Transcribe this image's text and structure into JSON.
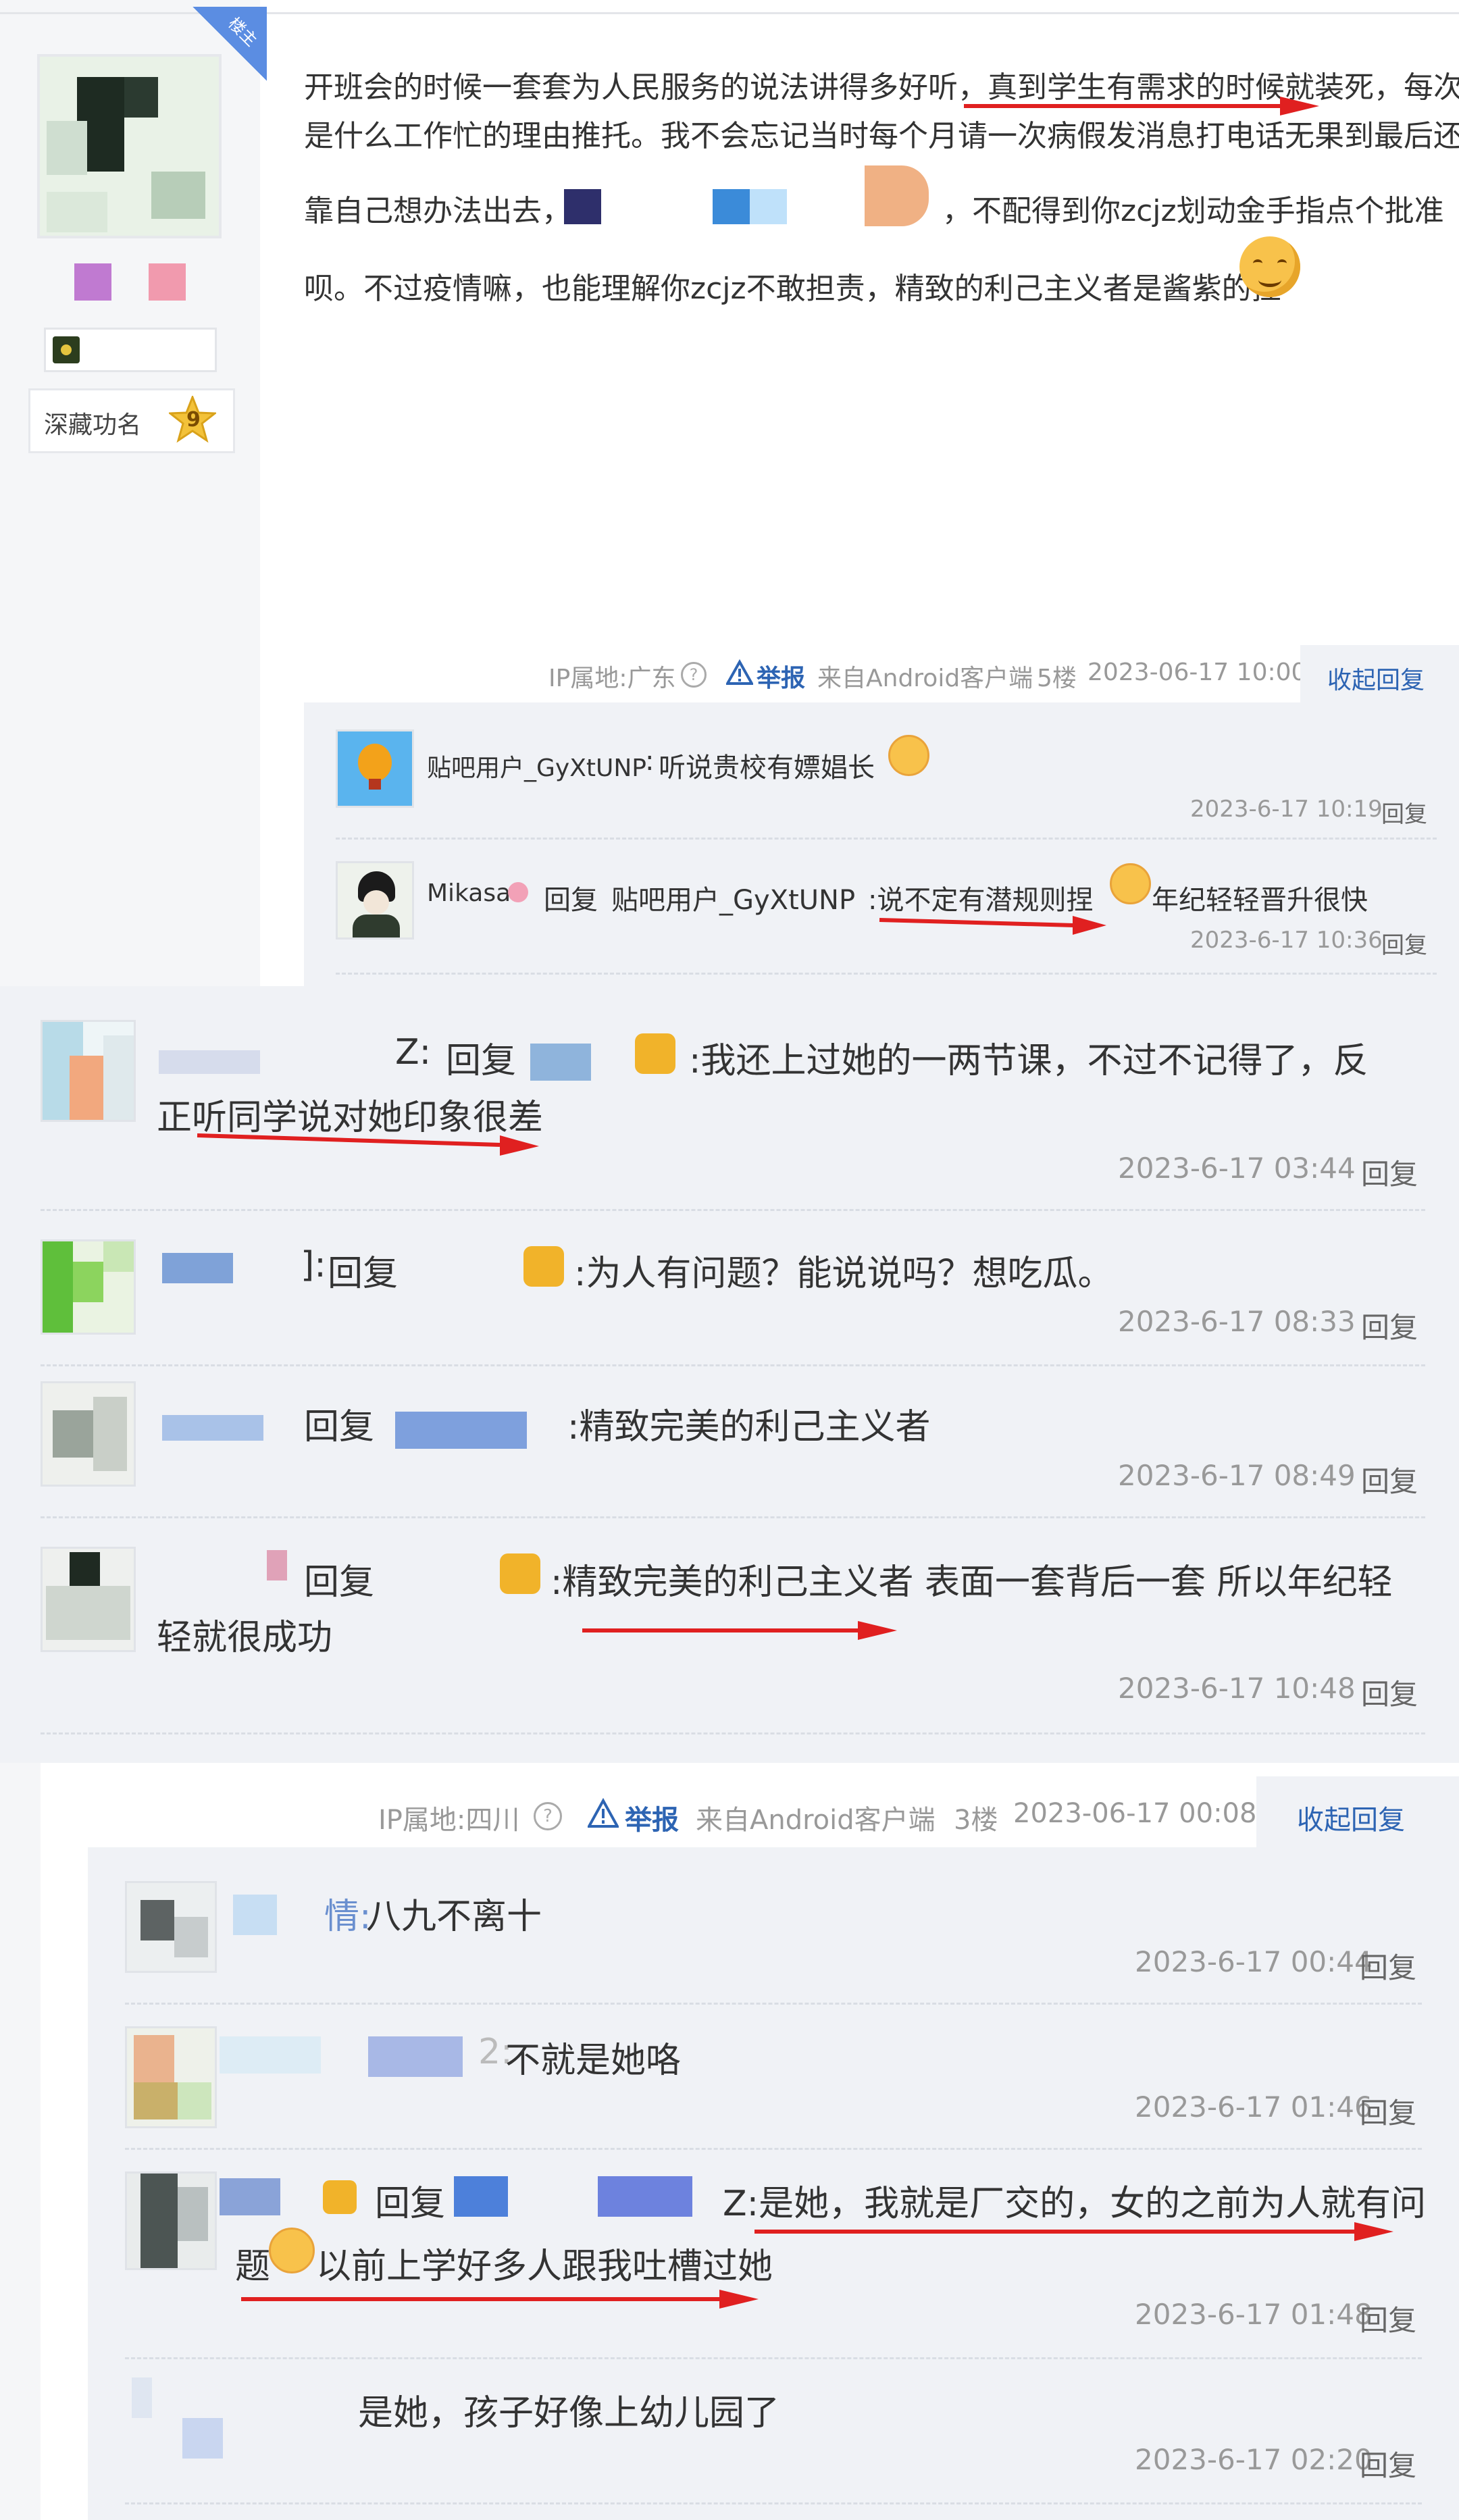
{
  "post": {
    "badge": "楼主",
    "lines": [
      "开班会的时候一套套为人民服务的说法讲得多好听，真到学生有需求的时候就装死，每次都",
      "是什么工作忙的理由推托。我不会忘记当时每个月请一次病假发消息打电话无果到最后还得",
      "靠自己想办法出去，",
      "，不配得到你zcjz划动金手指点个批准",
      "呗。不过疫情嘛，也能理解你zcjz不敢担责，精致的利己主义者是酱紫的捏"
    ],
    "rank": "深藏功名",
    "level": "9",
    "meta": {
      "ip": "IP属地:广东",
      "report": "举报",
      "client": "来自Android客户端",
      "floor": "5楼",
      "time": "2023-06-17 10:00",
      "collapse": "收起回复"
    },
    "replies": [
      {
        "user": "贴吧用户_GyXtUNP",
        "sep": ":",
        "text": "听说贵校有嫖娼长",
        "time": "2023-6-17 10:19",
        "reply": "回复"
      },
      {
        "user": "Mikasa",
        "reply_word": "回复",
        "target": "贴吧用户_GyXtUNP",
        "text1": ":说不定有潜规则捏",
        "text2": "年纪轻轻晋升很快",
        "time": "2023-6-17 10:36",
        "reply": "回复"
      }
    ]
  },
  "thread2": {
    "items": [
      {
        "lead": "Z:",
        "reply_word": "回复",
        "line1": ":我还上过她的一两节课，不过不记得了，反",
        "line2": "正听同学说对她印象很差",
        "time": "2023-6-17 03:44",
        "reply": "回复"
      },
      {
        "lead": "]:",
        "reply_word": "回复",
        "line1": ":为人有问题？能说说吗？想吃瓜。",
        "time": "2023-6-17 08:33",
        "reply": "回复"
      },
      {
        "reply_word": "回复",
        "line1": ":精致完美的利己主义者",
        "time": "2023-6-17 08:49",
        "reply": "回复"
      },
      {
        "reply_word": "回复",
        "line1": ":精致完美的利己主义者 表面一套背后一套 所以年纪轻",
        "line2": "轻就很成功",
        "time": "2023-6-17 10:48",
        "reply": "回复"
      }
    ]
  },
  "floor3": {
    "meta": {
      "ip": "IP属地:四川",
      "report": "举报",
      "client": "来自Android客户端",
      "floor": "3楼",
      "time": "2023-06-17 00:08",
      "collapse": "收起回复"
    },
    "items": [
      {
        "lead": "情:",
        "text": "八九不离十",
        "time": "2023-6-17 00:44",
        "reply": "回复"
      },
      {
        "lead": "2:",
        "text": "不就是她咯",
        "time": "2023-6-17 01:46",
        "reply": "回复"
      },
      {
        "reply_word": "回复",
        "line1": "Z:是她，我就是厂交的，女的之前为人就有问",
        "line2": "以前上学好多人跟我吐槽过她",
        "line2_prefix": "题",
        "time": "2023-6-17 01:48",
        "reply": "回复"
      },
      {
        "text": "是她，孩子好像上幼儿园了",
        "time": "2023-6-17 02:20",
        "reply": "回复"
      }
    ]
  },
  "colors": {
    "blue": "#2d64b3",
    "red": "#e02020",
    "panel": "#f0f2f6",
    "left_bg": "#f5f6f8"
  }
}
